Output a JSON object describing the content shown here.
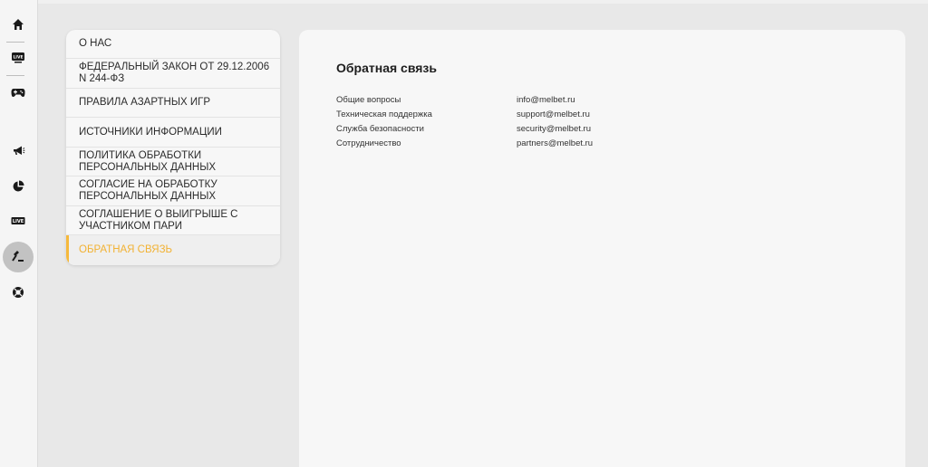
{
  "sidebar": {
    "icons": [
      "home-icon",
      "live-tv-icon",
      "gamepad-icon",
      "megaphone-icon",
      "pie-chart-icon",
      "live-icon",
      "gavel-icon",
      "lifebuoy-icon"
    ],
    "active_icon": "gavel-icon"
  },
  "menu": {
    "items": [
      {
        "label": "О НАС"
      },
      {
        "label": "ФЕДЕРАЛЬНЫЙ ЗАКОН ОТ 29.12.2006 N 244-ФЗ"
      },
      {
        "label": "ПРАВИЛА АЗАРТНЫХ ИГР"
      },
      {
        "label": "ИСТОЧНИКИ ИНФОРМАЦИИ"
      },
      {
        "label": "ПОЛИТИКА ОБРАБОТКИ ПЕРСОНАЛЬНЫХ ДАННЫХ"
      },
      {
        "label": "СОГЛАСИЕ НА ОБРАБОТКУ ПЕРСОНАЛЬНЫХ ДАННЫХ"
      },
      {
        "label": "СОГЛАШЕНИЕ О ВЫИГРЫШЕ С УЧАСТНИКОМ ПАРИ"
      },
      {
        "label": "ОБРАТНАЯ СВЯЗЬ"
      }
    ],
    "active_index": 7
  },
  "content": {
    "title": "Обратная связь",
    "contacts": [
      {
        "label": "Общие вопросы",
        "email": "info@melbet.ru"
      },
      {
        "label": "Техническая поддержка",
        "email": "support@melbet.ru"
      },
      {
        "label": "Служба безопасности",
        "email": "security@melbet.ru"
      },
      {
        "label": "Сотрудничество",
        "email": "partners@melbet.ru"
      }
    ]
  },
  "colors": {
    "accent": "#f6b93b",
    "background": "#e8e8e8",
    "card": "#f7f7f7"
  }
}
